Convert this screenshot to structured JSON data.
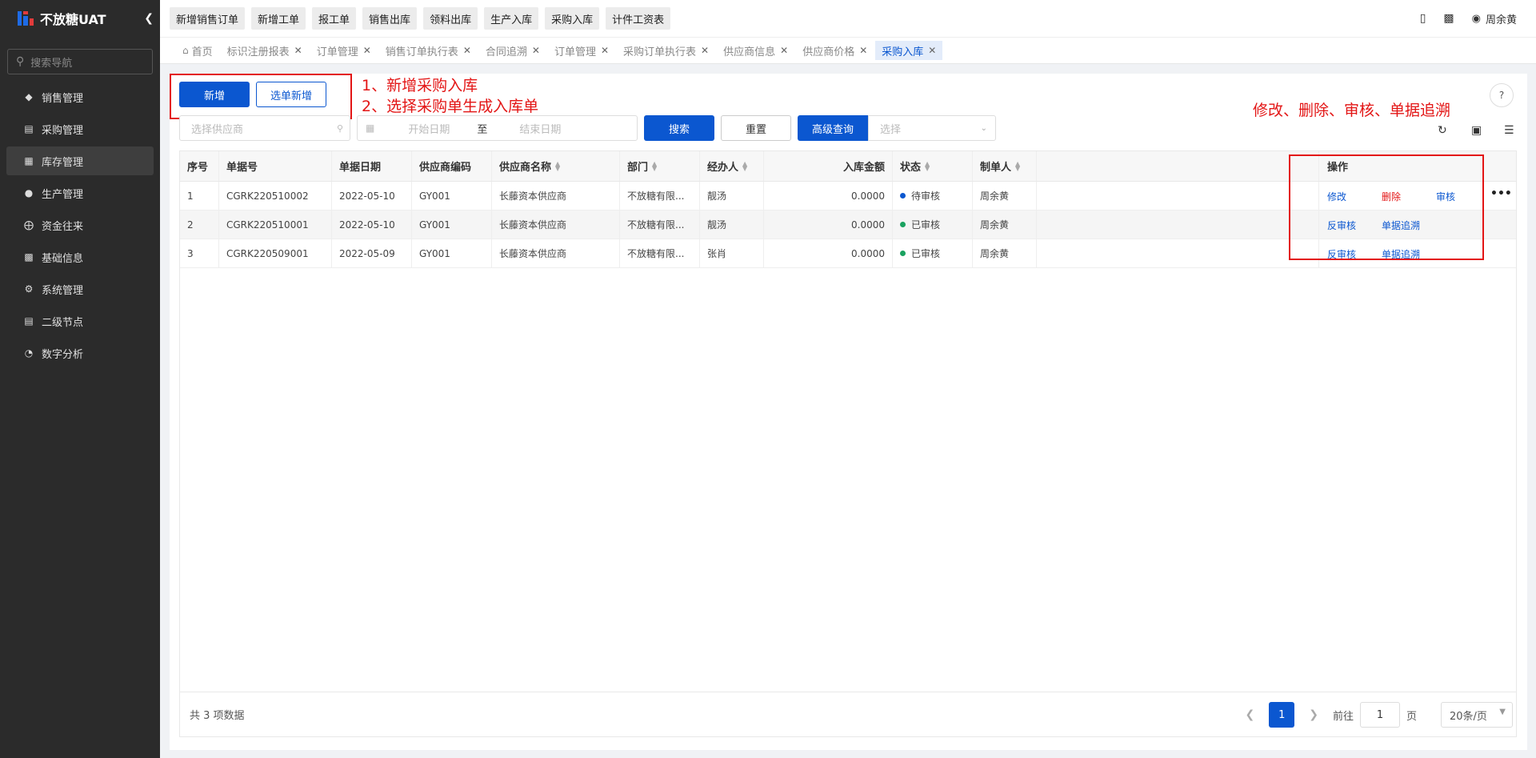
{
  "app": {
    "name": "不放糖UAT",
    "collapse_icon": "chevron-left-icon"
  },
  "sidebar": {
    "search_placeholder": "搜索导航",
    "items": [
      {
        "label": "销售管理",
        "icon": "tag-icon"
      },
      {
        "label": "采购管理",
        "icon": "cart-icon"
      },
      {
        "label": "库存管理",
        "icon": "warehouse-icon",
        "active": true
      },
      {
        "label": "生产管理",
        "icon": "factory-icon"
      },
      {
        "label": "资金往来",
        "icon": "money-icon"
      },
      {
        "label": "基础信息",
        "icon": "grid-icon"
      },
      {
        "label": "系统管理",
        "icon": "settings-icon"
      },
      {
        "label": "二级节点",
        "icon": "document-icon"
      },
      {
        "label": "数字分析",
        "icon": "pie-chart-icon"
      }
    ]
  },
  "topbar": {
    "quick_buttons": [
      "新增销售订单",
      "新增工单",
      "报工单",
      "销售出库",
      "领料出库",
      "生产入库",
      "采购入库",
      "计件工资表"
    ],
    "user_name": "周余黄"
  },
  "tabs": [
    {
      "label": "首页",
      "home": true
    },
    {
      "label": "标识注册报表"
    },
    {
      "label": "订单管理"
    },
    {
      "label": "销售订单执行表"
    },
    {
      "label": "合同追溯"
    },
    {
      "label": "订单管理"
    },
    {
      "label": "采购订单执行表"
    },
    {
      "label": "供应商信息"
    },
    {
      "label": "供应商价格"
    },
    {
      "label": "采购入库",
      "active": true
    }
  ],
  "toolbar": {
    "add_label": "新增",
    "select_add_label": "选单新增",
    "supplier_placeholder": "选择供应商",
    "start_date_placeholder": "开始日期",
    "date_separator": "至",
    "end_date_placeholder": "结束日期",
    "search_label": "搜索",
    "reset_label": "重置",
    "advanced_label": "高级查询",
    "select_placeholder": "选择"
  },
  "annotations": {
    "note1": "1、新增采购入库",
    "note2": "2、选择采购单生成入库单",
    "note3": "修改、删除、审核、单据追溯"
  },
  "table": {
    "headers": {
      "seq": "序号",
      "doc_no": "单据号",
      "doc_date": "单据日期",
      "supplier_code": "供应商编码",
      "supplier_name": "供应商名称",
      "dept": "部门",
      "handler": "经办人",
      "amount": "入库金额",
      "status": "状态",
      "creator": "制单人",
      "ops": "操作"
    },
    "rows": [
      {
        "seq": "1",
        "doc_no": "CGRK220510002",
        "doc_date": "2022-05-10",
        "supplier_code": "GY001",
        "supplier_name": "长藤资本供应商",
        "dept": "不放糖有限...",
        "handler": "靓汤",
        "amount": "0.0000",
        "status": "待审核",
        "status_color": "#0b57d0",
        "creator": "周余黄",
        "ops": [
          "修改",
          "删除",
          "审核"
        ],
        "more": "•••"
      },
      {
        "seq": "2",
        "doc_no": "CGRK220510001",
        "doc_date": "2022-05-10",
        "supplier_code": "GY001",
        "supplier_name": "长藤资本供应商",
        "dept": "不放糖有限...",
        "handler": "靓汤",
        "amount": "0.0000",
        "status": "已审核",
        "status_color": "#1aa260",
        "creator": "周余黄",
        "ops": [
          "反审核",
          "单据追溯"
        ]
      },
      {
        "seq": "3",
        "doc_no": "CGRK220509001",
        "doc_date": "2022-05-09",
        "supplier_code": "GY001",
        "supplier_name": "长藤资本供应商",
        "dept": "不放糖有限...",
        "handler": "张肖",
        "amount": "0.0000",
        "status": "已审核",
        "status_color": "#1aa260",
        "creator": "周余黄",
        "ops": [
          "反审核",
          "单据追溯"
        ]
      }
    ]
  },
  "footer": {
    "total_text": "共 3 项数据",
    "current_page": "1",
    "goto_label": "前往",
    "goto_value": "1",
    "page_unit": "页",
    "page_size": "20条/页"
  }
}
